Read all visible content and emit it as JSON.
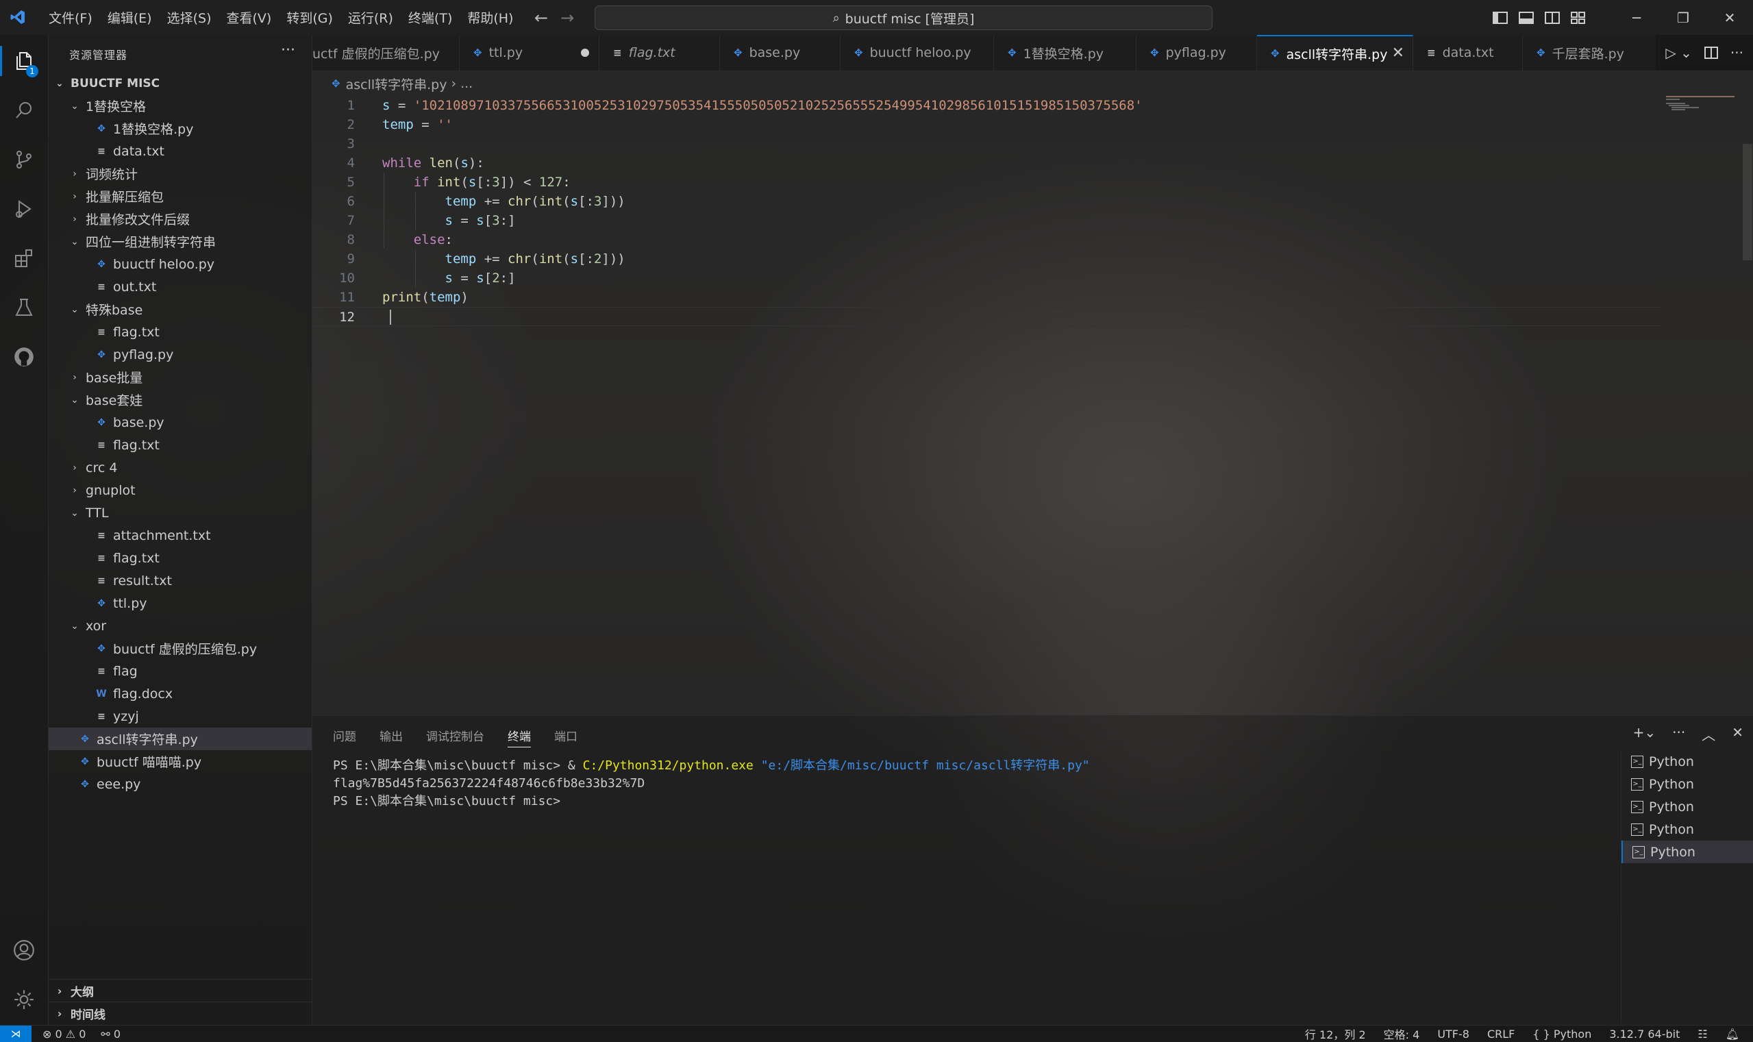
{
  "titlebar": {
    "menus": [
      "文件(F)",
      "编辑(E)",
      "选择(S)",
      "查看(V)",
      "转到(G)",
      "运行(R)",
      "终端(T)",
      "帮助(H)"
    ],
    "search_text": "buuctf misc [管理员]"
  },
  "activity": {
    "explorer_badge": "1"
  },
  "sidebar": {
    "header": "资源管理器",
    "root": "BUUCTF MISC",
    "tree": [
      {
        "label": "1替换空格",
        "type": "folder",
        "open": true,
        "depth": 1
      },
      {
        "label": "1替换空格.py",
        "type": "py",
        "depth": 2
      },
      {
        "label": "data.txt",
        "type": "txt",
        "depth": 2
      },
      {
        "label": "词频统计",
        "type": "folder",
        "open": false,
        "depth": 1
      },
      {
        "label": "批量解压缩包",
        "type": "folder",
        "open": false,
        "depth": 1
      },
      {
        "label": "批量修改文件后缀",
        "type": "folder",
        "open": false,
        "depth": 1
      },
      {
        "label": "四位一组进制转字符串",
        "type": "folder",
        "open": true,
        "depth": 1
      },
      {
        "label": "buuctf heloo.py",
        "type": "py",
        "depth": 2
      },
      {
        "label": "out.txt",
        "type": "txt",
        "depth": 2
      },
      {
        "label": "特殊base",
        "type": "folder",
        "open": true,
        "depth": 1
      },
      {
        "label": "flag.txt",
        "type": "txt",
        "depth": 2
      },
      {
        "label": "pyflag.py",
        "type": "py",
        "depth": 2
      },
      {
        "label": "base批量",
        "type": "folder",
        "open": false,
        "depth": 1
      },
      {
        "label": "base套娃",
        "type": "folder",
        "open": true,
        "depth": 1
      },
      {
        "label": "base.py",
        "type": "py",
        "depth": 2
      },
      {
        "label": "flag.txt",
        "type": "txt",
        "depth": 2
      },
      {
        "label": "crc 4",
        "type": "folder",
        "open": false,
        "depth": 1
      },
      {
        "label": "gnuplot",
        "type": "folder",
        "open": false,
        "depth": 1
      },
      {
        "label": "TTL",
        "type": "folder",
        "open": true,
        "depth": 1
      },
      {
        "label": "attachment.txt",
        "type": "txt",
        "depth": 2
      },
      {
        "label": "flag.txt",
        "type": "txt",
        "depth": 2
      },
      {
        "label": "result.txt",
        "type": "txt",
        "depth": 2
      },
      {
        "label": "ttl.py",
        "type": "py",
        "depth": 2
      },
      {
        "label": "xor",
        "type": "folder",
        "open": true,
        "depth": 1
      },
      {
        "label": "buuctf 虚假的压缩包.py",
        "type": "py",
        "depth": 2
      },
      {
        "label": "flag",
        "type": "txt",
        "depth": 2
      },
      {
        "label": "flag.docx",
        "type": "doc",
        "depth": 2
      },
      {
        "label": "yzyj",
        "type": "txt",
        "depth": 2
      },
      {
        "label": "ascll转字符串.py",
        "type": "py",
        "depth": 1,
        "selected": true
      },
      {
        "label": "buuctf 喵喵喵.py",
        "type": "py",
        "depth": 1
      },
      {
        "label": "eee.py",
        "type": "py",
        "depth": 1
      }
    ],
    "outline": "大纲",
    "timeline": "时间线"
  },
  "tabs": [
    {
      "label": "uctf 虚假的压缩包.py",
      "icon": "py"
    },
    {
      "label": "ttl.py",
      "icon": "py",
      "dirty": true
    },
    {
      "label": "flag.txt",
      "icon": "txt",
      "italic": true
    },
    {
      "label": "base.py",
      "icon": "py"
    },
    {
      "label": "buuctf heloo.py",
      "icon": "py"
    },
    {
      "label": "1替换空格.py",
      "icon": "py"
    },
    {
      "label": "pyflag.py",
      "icon": "py"
    },
    {
      "label": "ascll转字符串.py",
      "icon": "py",
      "active": true
    },
    {
      "label": "data.txt",
      "icon": "txt"
    },
    {
      "label": "千层套路.py",
      "icon": "py"
    }
  ],
  "breadcrumb": {
    "file": "ascll转字符串.py",
    "rest": "..."
  },
  "editor": {
    "s_value": "'1021089710337556653100525310297505354155505050521025256555254995410298561015151985150375568'",
    "line_numbers": [
      "1",
      "2",
      "3",
      "4",
      "5",
      "6",
      "7",
      "8",
      "9",
      "10",
      "11",
      "12"
    ],
    "current_line": 12
  },
  "panel": {
    "tabs": [
      "问题",
      "输出",
      "调试控制台",
      "终端",
      "端口"
    ],
    "active_tab": "终端",
    "terminal": {
      "prompt1": "PS E:\\脚本合集\\misc\\buuctf misc> & ",
      "exe": "C:/Python312/python.exe",
      "arg": " \"e:/脚本合集/misc/buuctf misc/ascll转字符串.py\"",
      "output": "flag%7B5d45fa256372224f48746c6fb8e33b32%7D",
      "prompt2": "PS E:\\脚本合集\\misc\\buuctf misc> "
    },
    "terminals": [
      "Python",
      "Python",
      "Python",
      "Python",
      "Python"
    ]
  },
  "statusbar": {
    "errors": "0",
    "warnings": "0",
    "ports": "0",
    "position": "行 12，列 2",
    "spaces": "空格: 4",
    "encoding": "UTF-8",
    "eol": "CRLF",
    "language": "Python",
    "interpreter": "3.12.7 64-bit"
  },
  "colors": {
    "accent": "#0078d4",
    "keyword": "#c586c0",
    "function": "#dcdcaa",
    "string": "#ce9178",
    "number": "#b5cea8"
  }
}
